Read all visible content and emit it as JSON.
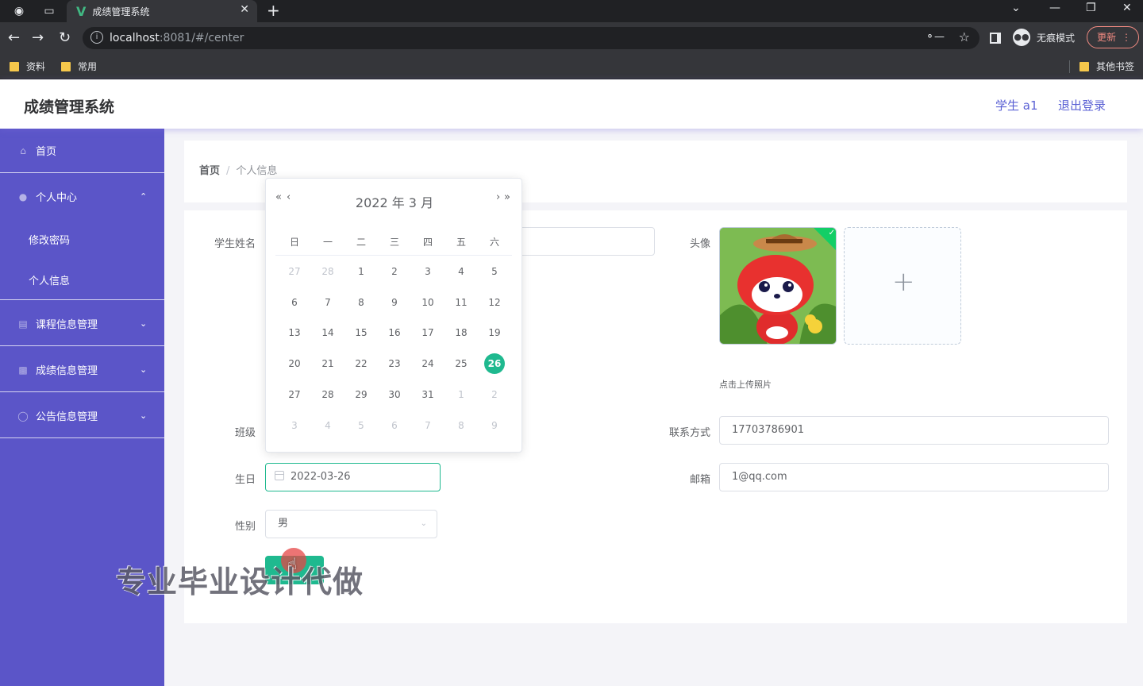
{
  "browser": {
    "tab_title": "成绩管理系统",
    "url_host": "localhost",
    "url_rest": ":8081/#/center",
    "incognito_label": "无痕模式",
    "update_label": "更新",
    "bookmarks": [
      "资料",
      "常用"
    ],
    "other_bookmarks": "其他书签"
  },
  "header": {
    "title": "成绩管理系统",
    "user": "学生 a1",
    "logout": "退出登录"
  },
  "sidebar": {
    "items": [
      {
        "label": "首页",
        "icon": "home-icon"
      },
      {
        "label": "个人中心",
        "icon": "user-icon",
        "expanded": true,
        "children": [
          "修改密码",
          "个人信息"
        ]
      },
      {
        "label": "课程信息管理",
        "icon": "clipboard-icon"
      },
      {
        "label": "成绩信息管理",
        "icon": "briefcase-icon"
      },
      {
        "label": "公告信息管理",
        "icon": "compass-icon"
      }
    ]
  },
  "breadcrumb": {
    "home": "首页",
    "current": "个人信息"
  },
  "form": {
    "name_label": "学生姓名",
    "avatar_label": "头像",
    "upload_tip": "点击上传照片",
    "class_label": "班级",
    "phone_label": "联系方式",
    "phone_value": "17703786901",
    "birthday_label": "生日",
    "birthday_value": "2022-03-26",
    "email_label": "邮箱",
    "email_value": "1@qq.com",
    "gender_label": "性别",
    "gender_value": "男"
  },
  "datepicker": {
    "year_month": "2022 年  3 月",
    "weekdays": [
      "日",
      "一",
      "二",
      "三",
      "四",
      "五",
      "六"
    ],
    "weeks": [
      [
        "27",
        "28",
        "1",
        "2",
        "3",
        "4",
        "5"
      ],
      [
        "6",
        "7",
        "8",
        "9",
        "10",
        "11",
        "12"
      ],
      [
        "13",
        "14",
        "15",
        "16",
        "17",
        "18",
        "19"
      ],
      [
        "20",
        "21",
        "22",
        "23",
        "24",
        "25",
        "26"
      ],
      [
        "27",
        "28",
        "29",
        "30",
        "31",
        "1",
        "2"
      ],
      [
        "3",
        "4",
        "5",
        "6",
        "7",
        "8",
        "9"
      ]
    ],
    "selected": "26"
  },
  "watermark": "专业毕业设计代做",
  "colors": {
    "accent": "#1fb98f",
    "sidebar": "#5b55c8",
    "link": "#5b61d4"
  }
}
